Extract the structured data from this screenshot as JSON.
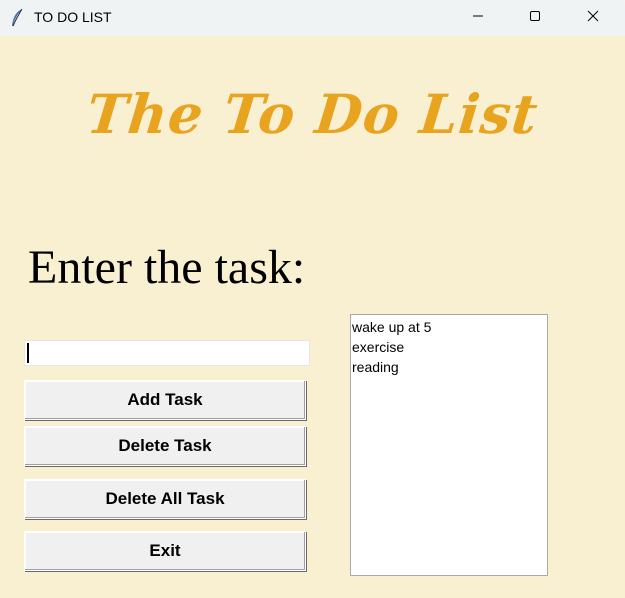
{
  "window": {
    "title": "TO DO LIST",
    "icon": "feather-icon",
    "controls": [
      "minimize-icon",
      "maximize-icon",
      "close-icon"
    ]
  },
  "app": {
    "heading": "The To Do List",
    "prompt": "Enter the task:",
    "task_entry": {
      "value": "",
      "placeholder": ""
    },
    "buttons": {
      "add": "Add Task",
      "delete": "Delete Task",
      "delete_all": "Delete All Task",
      "exit": "Exit"
    },
    "tasks": [
      "wake up at 5",
      "exercise",
      "reading"
    ]
  },
  "colors": {
    "background": "#f8f0d0",
    "heading": "#e8a31f",
    "titlebar": "#eff3f4"
  }
}
